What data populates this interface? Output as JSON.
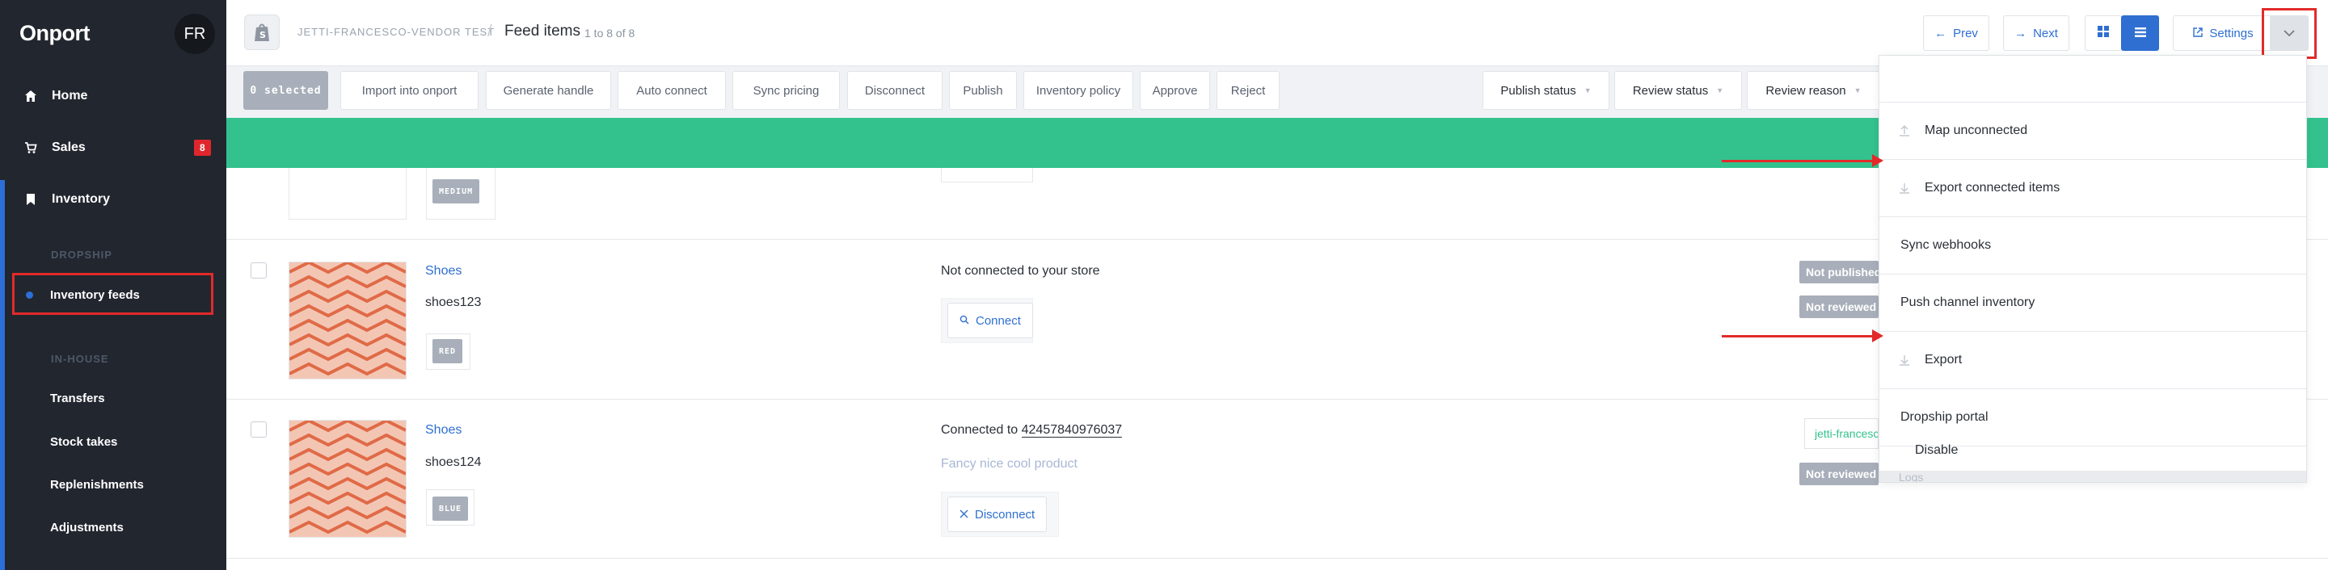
{
  "sidebar": {
    "brand": "Onport",
    "avatar": "FR",
    "items": [
      {
        "label": "Home",
        "icon": "home-icon"
      },
      {
        "label": "Sales",
        "icon": "cart-icon",
        "badge": "8"
      },
      {
        "label": "Inventory",
        "icon": "bookmark-icon"
      }
    ],
    "sections": {
      "dropship": "DROPSHIP",
      "inhouse": "IN-HOUSE"
    },
    "dropship_items": [
      "Inventory feeds"
    ],
    "inhouse_items": [
      "Transfers",
      "Stock takes",
      "Replenishments",
      "Adjustments"
    ]
  },
  "header": {
    "store": "JETTI-FRANCESCO-VENDOR TEST",
    "separator": "/",
    "title": "Feed items",
    "count": "1 to 8 of 8",
    "prev": "Prev",
    "next": "Next",
    "settings": "Settings"
  },
  "toolbar": {
    "selected": "0 selected",
    "actions": [
      "Import into onport",
      "Generate handle",
      "Auto connect",
      "Sync pricing",
      "Disconnect",
      "Publish",
      "Inventory policy",
      "Approve",
      "Reject"
    ],
    "filters": [
      "Publish status",
      "Review status",
      "Review reason"
    ]
  },
  "rows": [
    {
      "tag": "MEDIUM"
    },
    {
      "name": "Shoes",
      "sku": "shoes123",
      "tag": "RED",
      "connection": "Not connected to your store",
      "action": "Connect",
      "statuses": [
        "Not published",
        "Not reviewed"
      ]
    },
    {
      "name": "Shoes",
      "sku": "shoes124",
      "tag": "BLUE",
      "connection_prefix": "Connected to ",
      "connection_id": "42457840976037",
      "product_link": "Fancy nice cool product",
      "action": "Disconnect",
      "store_link": "jetti-francesco",
      "statuses": [
        "Not reviewed"
      ]
    }
  ],
  "dropdown": {
    "items": [
      "Map unconnected",
      "Export connected items",
      "Sync webhooks",
      "Push channel inventory",
      "Export",
      "Dropship portal",
      "Disable"
    ],
    "footer": "Logs"
  },
  "colors": {
    "accent": "#2e6fd1",
    "green": "#33c28d",
    "sidebar": "#22262f",
    "alert": "#e0262d"
  }
}
